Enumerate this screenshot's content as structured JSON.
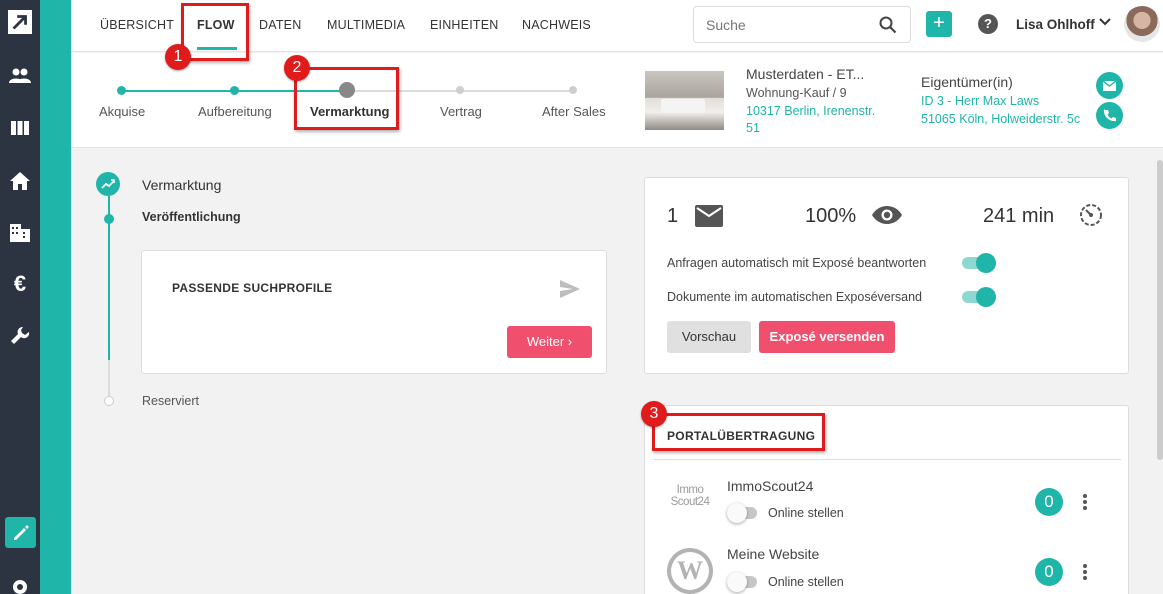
{
  "nav": {
    "tabs": [
      {
        "label": "ÜBERSICHT"
      },
      {
        "label": "FLOW"
      },
      {
        "label": "DATEN"
      },
      {
        "label": "MULTIMEDIA"
      },
      {
        "label": "EINHEITEN"
      },
      {
        "label": "NACHWEIS"
      }
    ],
    "active_tab": "FLOW"
  },
  "search": {
    "placeholder": "Suche"
  },
  "user": {
    "name": "Lisa Ohlhoff"
  },
  "stepper": {
    "steps": [
      {
        "label": "Akquise",
        "state": "done"
      },
      {
        "label": "Aufbereitung",
        "state": "done"
      },
      {
        "label": "Vermarktung",
        "state": "current"
      },
      {
        "label": "Vertrag",
        "state": "todo"
      },
      {
        "label": "After Sales",
        "state": "todo"
      }
    ]
  },
  "property": {
    "title": "Musterdaten - ET...",
    "subtitle": "Wohnung-Kauf / 9",
    "address": "10317 Berlin, Irenenstr. 51"
  },
  "owner": {
    "title": "Eigentümer(in)",
    "line1": "ID 3 - Herr Max Laws",
    "line2": "51065 Köln, Holweiderstr. 5c"
  },
  "timeline": {
    "title": "Vermarktung",
    "sub": "Veröffentlichung",
    "reserved": "Reserviert"
  },
  "suchprofile": {
    "title": "PASSENDE SUCHPROFILE",
    "button": "Weiter"
  },
  "stats": {
    "mails": "1",
    "views": "100%",
    "time": "241 min"
  },
  "auto": {
    "toggle1_label": "Anfragen automatisch mit Exposé beantworten",
    "toggle2_label": "Dokumente im automatischen Exposéversand",
    "toggle1_on": true,
    "toggle2_on": true,
    "preview_button": "Vorschau",
    "send_button": "Exposé versenden"
  },
  "portal": {
    "title": "PORTALÜBERTRAGUNG",
    "items": [
      {
        "name": "ImmoScout24",
        "logo_text_1": "Immo",
        "logo_text_2": "Scout24",
        "online_label": "Online stellen",
        "count": "0",
        "online": false
      },
      {
        "name": "Meine Website",
        "online_label": "Online stellen",
        "count": "0",
        "online": false
      }
    ]
  },
  "annotations": {
    "n1": "1",
    "n2": "2",
    "n3": "3"
  },
  "colors": {
    "accent": "#1fb5a8",
    "pink": "#f04f6e",
    "annotation": "#e01b1b",
    "sidebar": "#2b3440"
  }
}
